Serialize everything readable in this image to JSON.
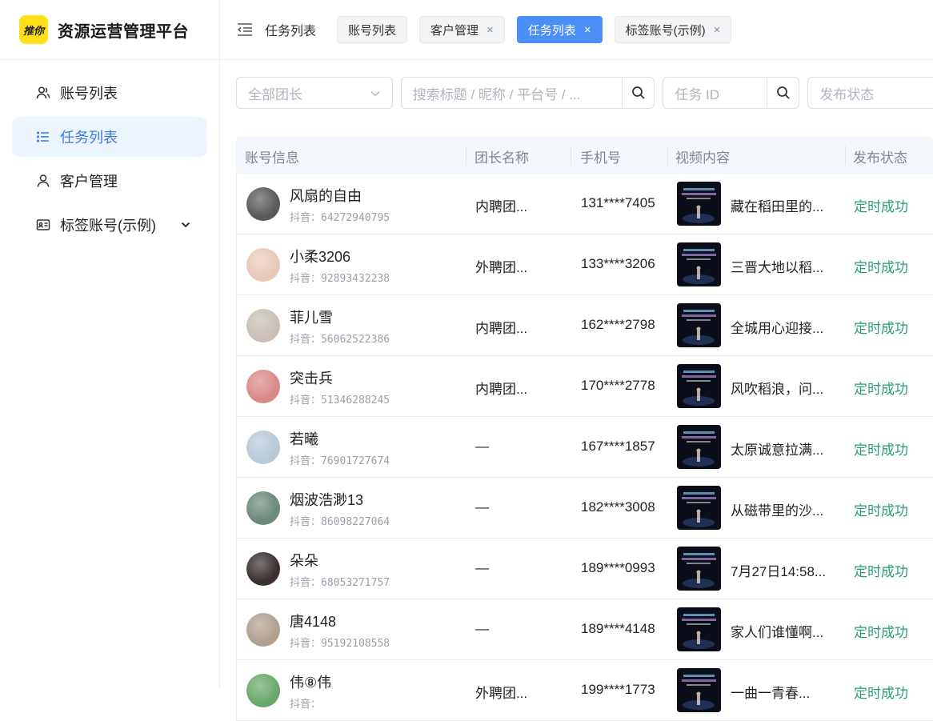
{
  "brand": {
    "logo_text": "推你",
    "title": "资源运营管理平台"
  },
  "sidebar": {
    "items": [
      {
        "label": "账号列表",
        "icon": "users-icon",
        "active": false
      },
      {
        "label": "任务列表",
        "icon": "list-icon",
        "active": true
      },
      {
        "label": "客户管理",
        "icon": "user-icon",
        "active": false
      },
      {
        "label": "标签账号(示例)",
        "icon": "id-card-icon",
        "active": false,
        "expandable": true
      }
    ]
  },
  "header": {
    "crumb": "任务列表",
    "tabs": [
      {
        "label": "账号列表",
        "closable": false,
        "active": false
      },
      {
        "label": "客户管理",
        "closable": true,
        "active": false
      },
      {
        "label": "任务列表",
        "closable": true,
        "active": true
      },
      {
        "label": "标签账号(示例)",
        "closable": true,
        "active": false
      }
    ],
    "close_glyph": "×"
  },
  "filters": {
    "team_placeholder": "全部团长",
    "search_placeholder": "搜索标题 / 昵称 / 平台号 / ...",
    "task_id_placeholder": "任务 ID",
    "status_placeholder": "发布状态"
  },
  "table": {
    "columns": [
      "账号信息",
      "团长名称",
      "手机号",
      "视频内容",
      "发布状态"
    ],
    "dy_label": "抖音：",
    "rows": [
      {
        "nick": "风扇的自由",
        "dy": "64272940795",
        "team": "内聘团...",
        "phone": "131****7405",
        "video": "藏在稻田里的...",
        "status": "定时成功",
        "avatar_color": "#5a5a5a"
      },
      {
        "nick": "小柔3206",
        "dy": "92893432238",
        "team": "外聘团...",
        "phone": "133****3206",
        "video": "三晋大地以稻...",
        "status": "定时成功",
        "avatar_color": "#e8c9b8"
      },
      {
        "nick": "菲儿雪",
        "dy": "56062522386",
        "team": "内聘团...",
        "phone": "162****2798",
        "video": "全城用心迎接...",
        "status": "定时成功",
        "avatar_color": "#c8c0b8"
      },
      {
        "nick": "突击兵",
        "dy": "51346288245",
        "team": "内聘团...",
        "phone": "170****2778",
        "video": "风吹稻浪，问...",
        "status": "定时成功",
        "avatar_color": "#d98a86"
      },
      {
        "nick": "若曦",
        "dy": "76901727674",
        "team": "—",
        "phone": "167****1857",
        "video": "太原诚意拉满...",
        "status": "定时成功",
        "avatar_color": "#b9c9d8"
      },
      {
        "nick": "烟波浩渺13",
        "dy": "86098227064",
        "team": "—",
        "phone": "182****3008",
        "video": "从磁带里的沙...",
        "status": "定时成功",
        "avatar_color": "#6a8a7a"
      },
      {
        "nick": "朵朵",
        "dy": "68053271757",
        "team": "—",
        "phone": "189****0993",
        "video": "7月27日14:58...",
        "status": "定时成功",
        "avatar_color": "#3a3030"
      },
      {
        "nick": "唐4148",
        "dy": "95192108558",
        "team": "—",
        "phone": "189****4148",
        "video": "家人们谁懂啊...",
        "status": "定时成功",
        "avatar_color": "#b0a090"
      },
      {
        "nick": "伟⑧伟",
        "dy": "",
        "team": "外聘团...",
        "phone": "199****1773",
        "video": "一曲一青春...",
        "status": "定时成功",
        "avatar_color": "#6aa86a"
      }
    ]
  },
  "colors": {
    "accent": "#4b8ef5",
    "status_green": "#2a9d6f",
    "active_bg": "#ecf4fe"
  }
}
